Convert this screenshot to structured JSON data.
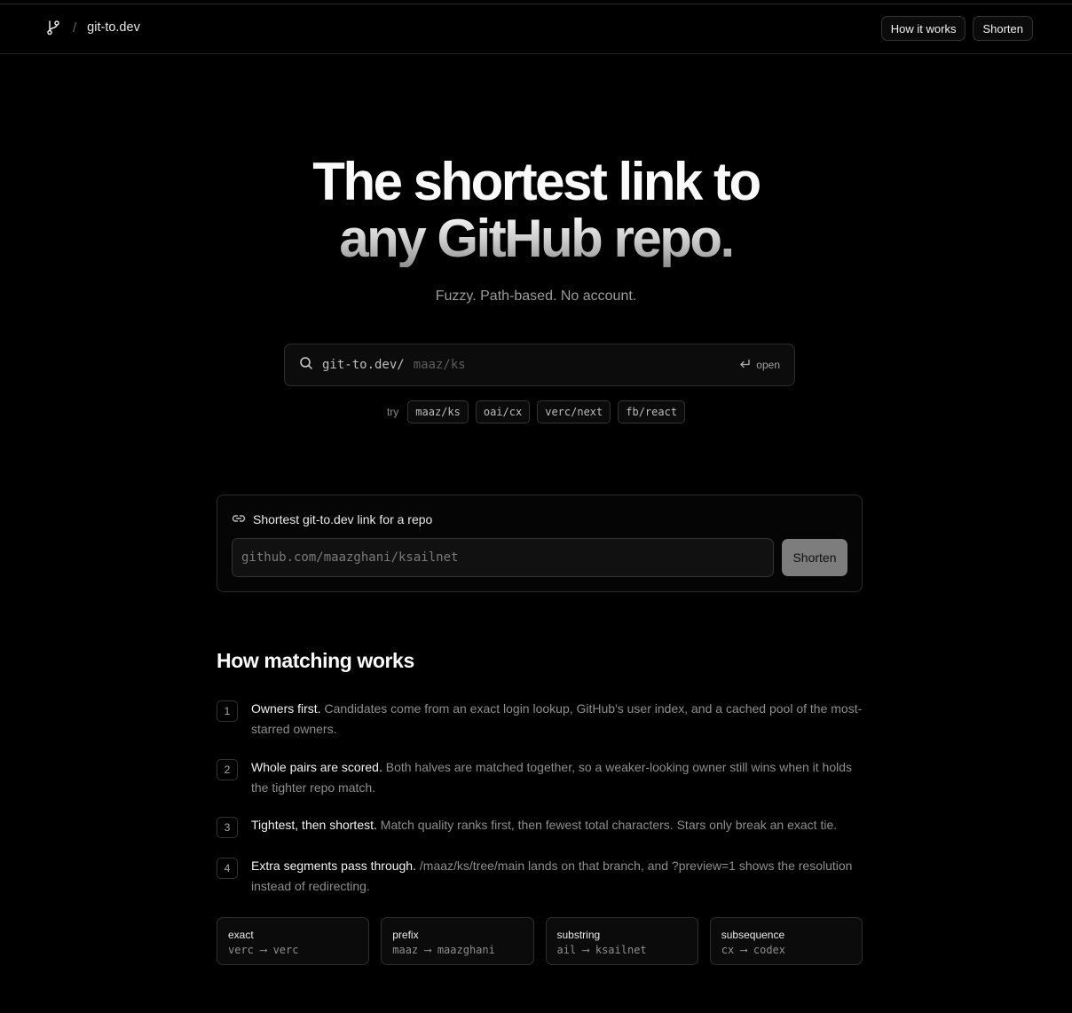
{
  "header": {
    "separator": "/",
    "site_name": "git-to.dev",
    "nav": [
      {
        "label": "How it works"
      },
      {
        "label": "Shorten"
      }
    ]
  },
  "hero": {
    "title_line1": "The shortest link to",
    "title_line2": "any GitHub repo.",
    "subtitle": "Fuzzy. Path-based. No account."
  },
  "search": {
    "prefix": "git-to.dev/",
    "placeholder": "maaz/ks",
    "hint": "open",
    "try_label": "try",
    "suggestions": [
      "maaz/ks",
      "oai/cx",
      "verc/next",
      "fb/react"
    ]
  },
  "shorten": {
    "title": "Shortest git-to.dev link for a repo",
    "placeholder": "github.com/maazghani/ksailnet",
    "button": "Shorten"
  },
  "how": {
    "title": "How matching works",
    "steps": [
      {
        "num": "1",
        "lead": "Owners first.",
        "text": " Candidates come from an exact login lookup, GitHub's user index, and a cached pool of the most-starred owners."
      },
      {
        "num": "2",
        "lead": "Whole pairs are scored.",
        "text": " Both halves are matched together, so a weaker-looking owner still wins when it holds the tighter repo match."
      },
      {
        "num": "3",
        "lead": "Tightest, then shortest.",
        "text": " Match quality ranks first, then fewest total characters. Stars only break an exact tie."
      },
      {
        "num": "4",
        "lead": "Extra segments pass through.",
        "text": " /maaz/ks/tree/main lands on that branch, and ?preview=1 shows the resolution instead of redirecting."
      }
    ],
    "types": [
      {
        "kind": "exact",
        "example": "verc ⟶ verc"
      },
      {
        "kind": "prefix",
        "example": "maaz ⟶ maazghani"
      },
      {
        "kind": "substring",
        "example": "ail ⟶ ksailnet"
      },
      {
        "kind": "subsequence",
        "example": "cx ⟶ codex"
      }
    ]
  }
}
